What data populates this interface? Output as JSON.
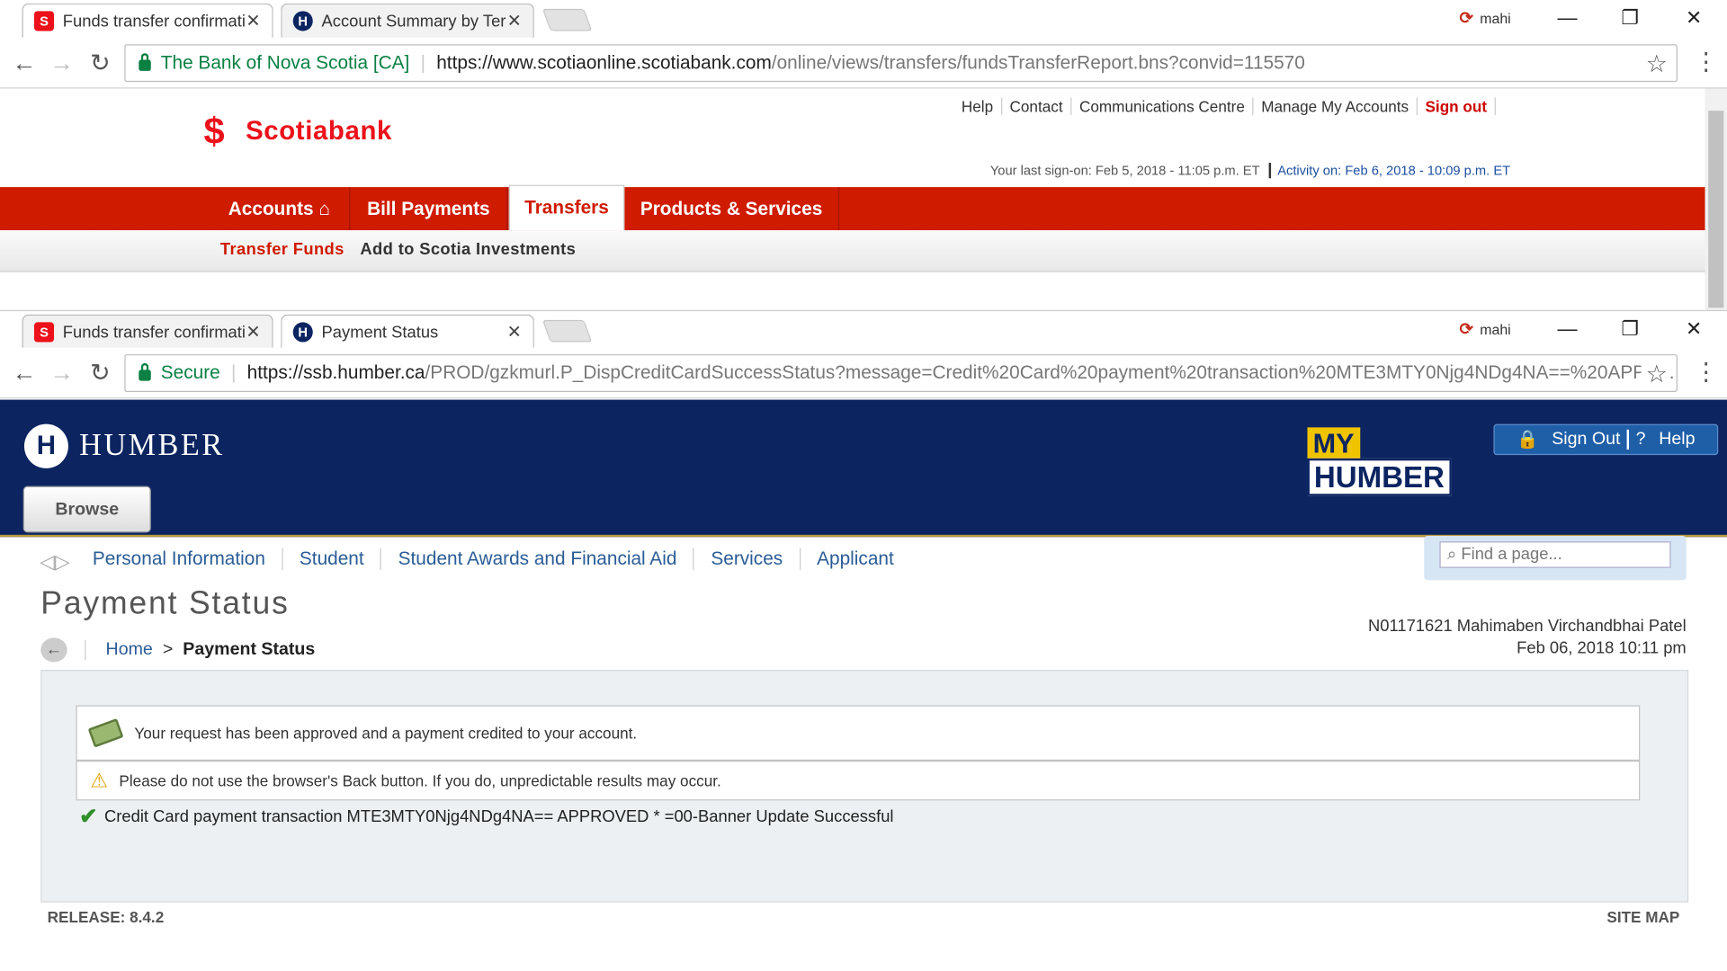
{
  "window1": {
    "tabs": [
      {
        "title": "Funds transfer confirmati",
        "active": true
      },
      {
        "title": "Account Summary by Ter",
        "active": false
      }
    ],
    "profile": "mahi",
    "omnibox": {
      "site_name": "The Bank of Nova Scotia [CA]",
      "url_host": "https://www.scotiaonline.scotiabank.com",
      "url_path": "/online/views/transfers/fundsTransferReport.bns?convid=115570"
    }
  },
  "scotiabank": {
    "logo_text": "Scotiabank",
    "top_links": [
      "Help",
      "Contact",
      "Communications Centre",
      "Manage My Accounts",
      "Sign out"
    ],
    "last_signon": "Your last sign-on: Feb 5, 2018 - 11:05 p.m. ET",
    "activity": "Activity on: Feb 6, 2018 - 10:09 p.m. ET",
    "main_tabs": [
      "Accounts",
      "Bill Payments",
      "Transfers",
      "Products & Services"
    ],
    "sub_tabs": [
      "Transfer Funds",
      "Add to Scotia Investments"
    ],
    "colors": {
      "brand_red": "#ec111a",
      "bar_red": "#cf1b00"
    }
  },
  "window2": {
    "tabs": [
      {
        "title": "Funds transfer confirmati",
        "active": false
      },
      {
        "title": "Payment Status",
        "active": true
      }
    ],
    "profile": "mahi",
    "omnibox": {
      "secure_label": "Secure",
      "url_host": "https://ssb.humber.ca",
      "url_path": "/PROD/gzkmurl.P_DispCreditCardSuccessStatus?message=Credit%20Card%20payment%20transaction%20MTE3MTY0Njg4NDg4NA==%20APPR..."
    }
  },
  "humber": {
    "logo_text": "HUMBER",
    "browse_label": "Browse",
    "myhumber": {
      "my": "MY",
      "humber": "HUMBER"
    },
    "sign_out": "Sign Out",
    "help": "Help",
    "nav": [
      "Personal Information",
      "Student",
      "Student Awards and Financial Aid",
      "Services",
      "Applicant"
    ],
    "find_placeholder": "Find a page...",
    "page_title": "Payment Status",
    "breadcrumb": {
      "home": "Home",
      "current": "Payment Status"
    },
    "user_id": "N01171621 Mahimaben Virchandbhai Patel",
    "datetime": "Feb 06, 2018 10:11 pm",
    "messages": {
      "approved": "Your request has been approved and a payment credited to your account.",
      "warning": "Please do not use the browser's Back button. If you do, unpredictable results may occur.",
      "success": "Credit Card payment transaction MTE3MTY0Njg4NDg4NA== APPROVED * =00-Banner Update Successful"
    },
    "release": "RELEASE: 8.4.2",
    "site_map": "SITE MAP",
    "colors": {
      "banner": "#0c2561",
      "link": "#2a5c96",
      "myhumber_yellow": "#f1c400"
    }
  }
}
